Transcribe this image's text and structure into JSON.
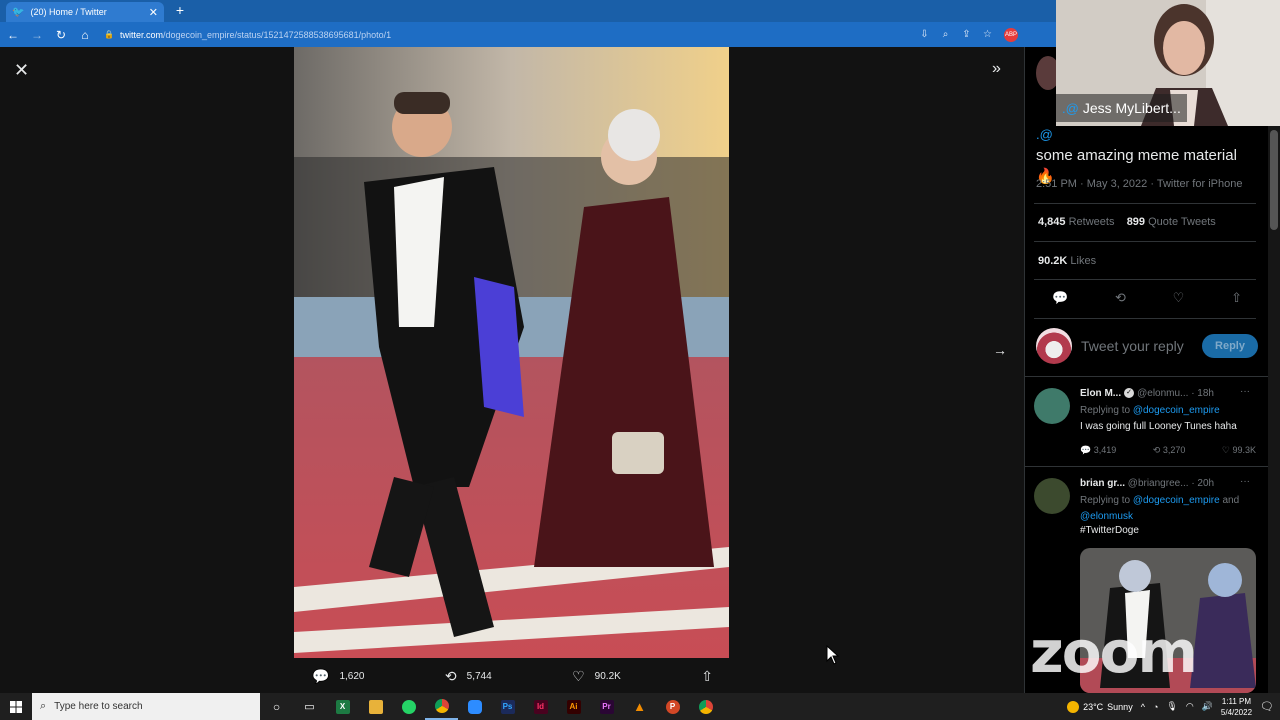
{
  "browser": {
    "tab_title": "(20) Home / Twitter",
    "url_host": "twitter.com",
    "url_path": "/dogecoin_empire/status/1521472588538695681/photo/1"
  },
  "photo_actions": {
    "replies": "1,620",
    "retweets": "5,744",
    "likes": "90.2K"
  },
  "tweet": {
    "handle_fragment": ".@",
    "text": "some amazing meme material 🔥",
    "meta": "2:51 PM · May 3, 2022 · Twitter for iPhone",
    "retweets_count": "4,845",
    "retweets_label": "Retweets",
    "quotes_count": "899",
    "quotes_label": "Quote Tweets",
    "likes_count": "90.2K",
    "likes_label": "Likes"
  },
  "reply_box": {
    "placeholder": "Tweet your reply",
    "button": "Reply"
  },
  "replies": [
    {
      "name": "Elon M...",
      "handle": "@elonmu...",
      "time": "· 18h",
      "replying_prefix": "Replying to",
      "replying_to": "@dogecoin_empire",
      "body": "I was going full Looney Tunes haha",
      "reply_count": "3,419",
      "retweet_count": "3,270",
      "like_count": "99.3K"
    },
    {
      "name": "brian gr...",
      "handle": "@briangree...",
      "time": "· 20h",
      "replying_prefix": "Replying to",
      "replying_to": "@dogecoin_empire",
      "replying_and": "and",
      "replying_to2": "@elonmusk",
      "hashtag": "#TwitterDoge"
    }
  ],
  "zoom": {
    "participant_name": "Jess MyLibert...",
    "logo": "zoom"
  },
  "taskbar": {
    "search_placeholder": "Type here to search",
    "temperature": "23°C",
    "weather": "Sunny",
    "time": "1:11 PM",
    "date": "5/4/2022"
  },
  "colors": {
    "twitter_blue": "#1d9bf0",
    "chrome_blue": "#1e6dc4",
    "panel_bg": "#000000"
  },
  "icons": [
    "close-icon",
    "expand-icon",
    "next-arrow-icon",
    "reply-icon",
    "retweet-icon",
    "like-icon",
    "share-icon",
    "windows-icon",
    "search-icon"
  ]
}
